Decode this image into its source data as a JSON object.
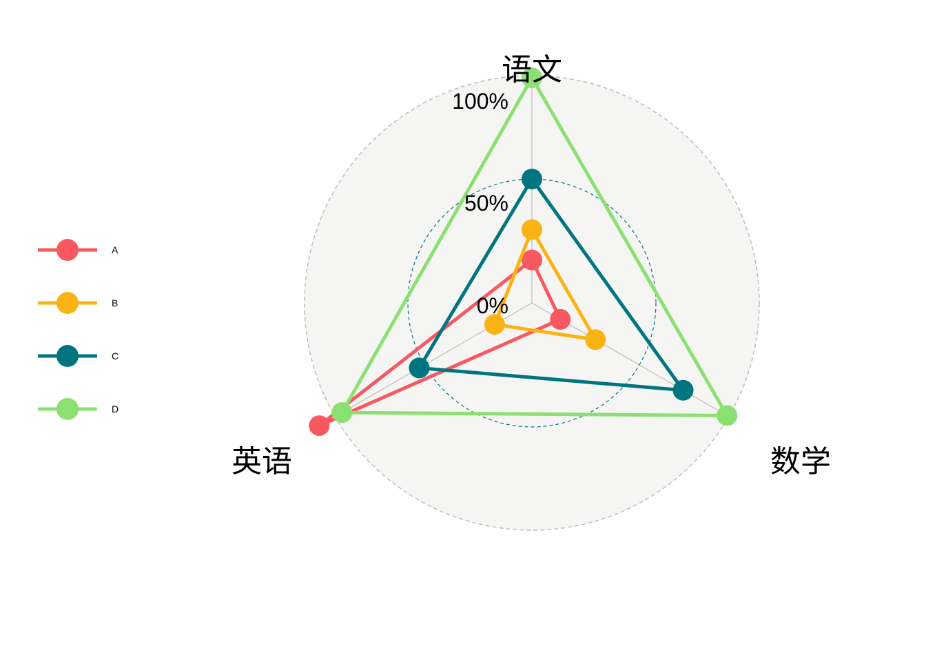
{
  "chart_data": {
    "type": "radar",
    "axes": [
      "语文",
      "数学",
      "英语"
    ],
    "tick_labels": [
      "0%",
      "50%",
      "100%"
    ],
    "range": [
      0,
      1
    ],
    "series": [
      {
        "name": "A",
        "color": "#F8585F",
        "values": [
          0.1,
          0.05,
          1.1
        ]
      },
      {
        "name": "B",
        "color": "#FBB313",
        "values": [
          0.25,
          0.25,
          0.1
        ]
      },
      {
        "name": "C",
        "color": "#00757F",
        "values": [
          0.5,
          0.75,
          0.53
        ]
      },
      {
        "name": "D",
        "color": "#8CE071",
        "values": [
          1.0,
          1.0,
          0.97
        ]
      }
    ],
    "legend_position": "left",
    "background_circle_color": "#F5F5F4",
    "grid": true
  }
}
